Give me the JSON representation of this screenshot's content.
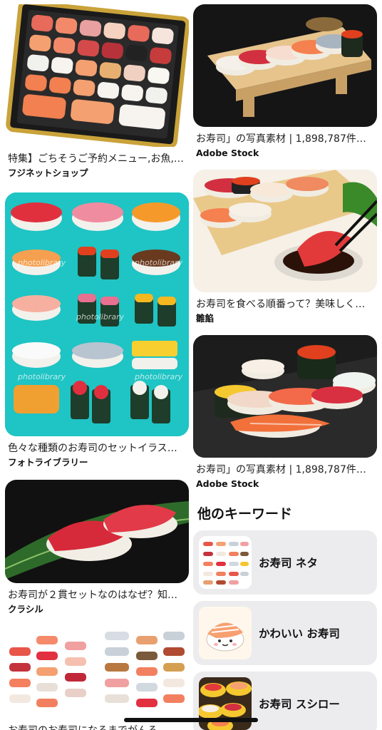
{
  "left_column": [
    {
      "title": "特集】ごちそうご予約メニュー,お魚,…",
      "source": "フジネットショップ"
    },
    {
      "title": "色々な種類のお寿司のセットイラス…",
      "source": "フォトライブラリー",
      "watermark": "photolibrary"
    },
    {
      "title": "お寿司が２貫セットなのはなぜ？知…",
      "source": "クラシル"
    },
    {
      "title": "お寿司のお寿司になるまでがんる…"
    }
  ],
  "right_column": [
    {
      "title": "お寿司」の写真素材 | 1,898,787件…",
      "source": "Adobe Stock"
    },
    {
      "title": "お寿司を食べる順番って？美味しく…",
      "source": "雛餡"
    },
    {
      "title": "お寿司」の写真素材 | 1,898,787件…",
      "source": "Adobe Stock"
    }
  ],
  "keywords": {
    "heading": "他のキーワード",
    "items": [
      {
        "label": "お寿司 ネタ",
        "icon": "sushi-chart-thumbnail"
      },
      {
        "label": "かわいい お寿司",
        "icon": "cute-sushi-thumbnail"
      },
      {
        "label": "お寿司 スシロー",
        "icon": "sushiro-plates-thumbnail"
      }
    ]
  },
  "colors": {
    "background": "#ffffff",
    "keyword_bg": "#ececee",
    "teal": "#1fc4c4"
  }
}
